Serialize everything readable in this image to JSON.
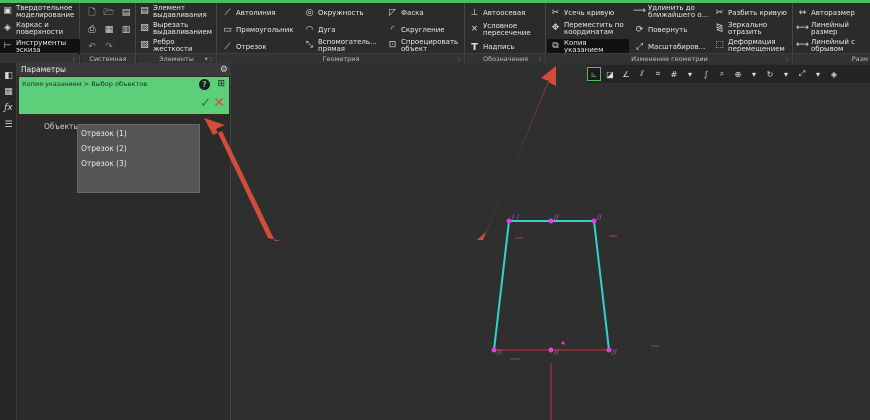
{
  "ribbon": {
    "left_tabs": [
      {
        "label": "Твердотельное моделирование",
        "line1": "Твердотельное",
        "line2": "моделирование"
      },
      {
        "label": "Каркас и поверхности",
        "line1": "Каркас и",
        "line2": "поверхности"
      },
      {
        "label": "Инструменты эскиза",
        "line1": "Инструменты",
        "line2": "эскиза"
      }
    ],
    "groups": {
      "system": "Системная",
      "elements": "Элементы",
      "geometry": "Геометрия",
      "designations": "Обозначения",
      "edit_geometry": "Изменение геометрии",
      "size": "Разм"
    },
    "elements_items": {
      "extrude_1": "Элемент",
      "extrude_2": "выдавливания",
      "cut_1": "Вырезать",
      "cut_2": "выдавливанием",
      "rib_1": "Ребро",
      "rib_2": "жесткости"
    },
    "geometry_items": {
      "autoline": "Автолиния",
      "circle": "Окружность",
      "chamfer": "Фаска",
      "rectangle": "Прямоугольник",
      "arc": "Дуга",
      "fillet": "Скругление",
      "segment": "Отрезок",
      "aux_1": "Вспомогатель...",
      "aux_2": "прямая",
      "project_1": "Спроецировать",
      "project_2": "объект"
    },
    "designation_items": {
      "autoaxis": "Автоосевая",
      "cond_1": "Условное",
      "cond_2": "пересечение",
      "label": "Надпись"
    },
    "edit_items": {
      "trim": "Усечь кривую",
      "move_1": "Переместить по",
      "move_2": "координатам",
      "copy_1": "Копия",
      "copy_2": "указанием",
      "extend_1": "Удлинить до",
      "extend_2": "ближайшего о...",
      "rotate": "Повернуть",
      "scale": "Масштабиров...",
      "split": "Разбить кривую",
      "mirror_1": "Зеркально",
      "mirror_2": "отразить",
      "deform_1": "Деформация",
      "deform_2": "перемещением"
    },
    "size_items": {
      "autosize": "Авторазмер",
      "lin_1": "Линейный",
      "lin_2": "размер",
      "linbr_1": "Линейный с",
      "linbr_2": "обрывом"
    }
  },
  "panel": {
    "title": "Параметры",
    "breadcrumb": "Копия указанием > Выбор объектов",
    "objects_label": "Объекты:",
    "objects": [
      "Отрезок (1)",
      "Отрезок (2)",
      "Отрезок (3)"
    ]
  },
  "colors": {
    "accent_green": "#4fbf5e",
    "panel_green": "#5ccf7b",
    "sketch_line": "#2fd3d3",
    "selection_point": "#e23ed8",
    "arrow": "#e0503c"
  },
  "icons": {
    "help": "?",
    "ok": "✓",
    "cancel": "✕",
    "gear": "⚙"
  }
}
